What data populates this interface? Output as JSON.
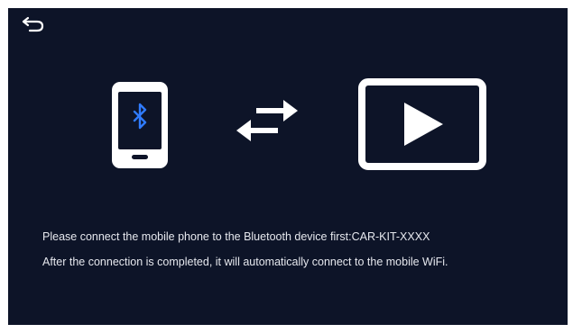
{
  "header": {
    "back_icon": "back-arrow-icon"
  },
  "illustration": {
    "phone_icon": "smartphone-bluetooth-icon",
    "bluetooth_icon": "bluetooth-icon",
    "bluetooth_color": "#2f7bff",
    "transfer_icon": "swap-arrows-icon",
    "display_icon": "video-play-display-icon"
  },
  "instructions": {
    "line1": "Please connect the mobile phone to the Bluetooth device first:CAR-KIT-XXXX",
    "line2": "After the connection is completed, it will automatically connect to the mobile WiFi."
  },
  "colors": {
    "background": "#0d1428",
    "foreground": "#ffffff"
  }
}
